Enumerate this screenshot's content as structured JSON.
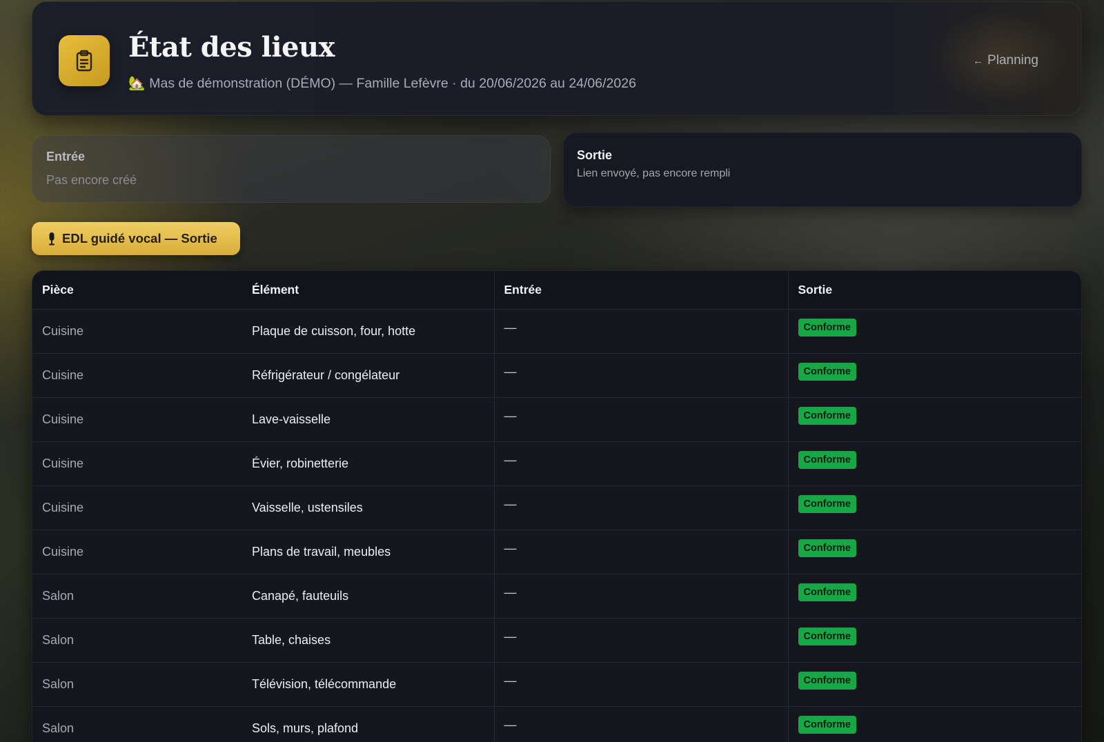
{
  "header": {
    "title": "État des lieux",
    "house_icon": "🏡",
    "subtitle": "Mas de démonstration (DÉMO) — Famille Lefèvre · du 20/06/2026 au 24/06/2026",
    "back_arrow": "←",
    "back_label": "Planning",
    "logo_icon": "clipboard-icon"
  },
  "cards": {
    "entree": {
      "title": "Entrée",
      "status": "Pas encore créé"
    },
    "sortie": {
      "title": "Sortie",
      "status": "Lien envoyé, pas encore rempli"
    }
  },
  "voice_button": {
    "icon": "microphone-icon",
    "label": "EDL guidé vocal — Sortie"
  },
  "table": {
    "headers": {
      "piece": "Pièce",
      "element": "Élément",
      "entree": "Entrée",
      "sortie": "Sortie"
    },
    "rows": [
      {
        "piece": "Cuisine",
        "element": "Plaque de cuisson, four, hotte",
        "entree": "—",
        "sortie": "Conforme"
      },
      {
        "piece": "Cuisine",
        "element": "Réfrigérateur / congélateur",
        "entree": "—",
        "sortie": "Conforme"
      },
      {
        "piece": "Cuisine",
        "element": "Lave-vaisselle",
        "entree": "—",
        "sortie": "Conforme"
      },
      {
        "piece": "Cuisine",
        "element": "Évier, robinetterie",
        "entree": "—",
        "sortie": "Conforme"
      },
      {
        "piece": "Cuisine",
        "element": "Vaisselle, ustensiles",
        "entree": "—",
        "sortie": "Conforme"
      },
      {
        "piece": "Cuisine",
        "element": "Plans de travail, meubles",
        "entree": "—",
        "sortie": "Conforme"
      },
      {
        "piece": "Salon",
        "element": "Canapé, fauteuils",
        "entree": "—",
        "sortie": "Conforme"
      },
      {
        "piece": "Salon",
        "element": "Table, chaises",
        "entree": "—",
        "sortie": "Conforme"
      },
      {
        "piece": "Salon",
        "element": "Télévision, télécommande",
        "entree": "—",
        "sortie": "Conforme"
      },
      {
        "piece": "Salon",
        "element": "Sols, murs, plafond",
        "entree": "—",
        "sortie": "Conforme"
      }
    ]
  },
  "colors": {
    "accent_gold": "#e6b93a",
    "badge_green": "#17a845",
    "panel_dark": "#15171f"
  }
}
